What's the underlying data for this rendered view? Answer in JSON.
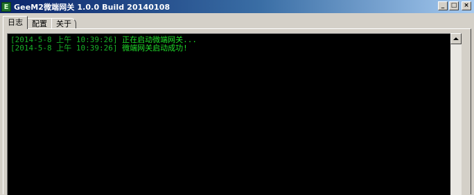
{
  "window": {
    "icon_letter": "E",
    "title": "GeeM2微端网关 1.0.0 Build 20140108",
    "buttons": {
      "minimize": "_",
      "maximize": "□",
      "close": "×"
    }
  },
  "tabs": [
    {
      "label": "日志",
      "active": true
    },
    {
      "label": "配置",
      "active": false
    },
    {
      "label": "关于",
      "active": false
    }
  ],
  "log": [
    {
      "timestamp": "[2014-5-8 上午 10:39:26]",
      "message": "正在启动微端网关..."
    },
    {
      "timestamp": "[2014-5-8 上午 10:39:26]",
      "message": "微端网关启动成功!"
    }
  ],
  "colors": {
    "log_background": "#000000",
    "log_text": "#1fe02a",
    "title_bar": "#0a246a"
  }
}
